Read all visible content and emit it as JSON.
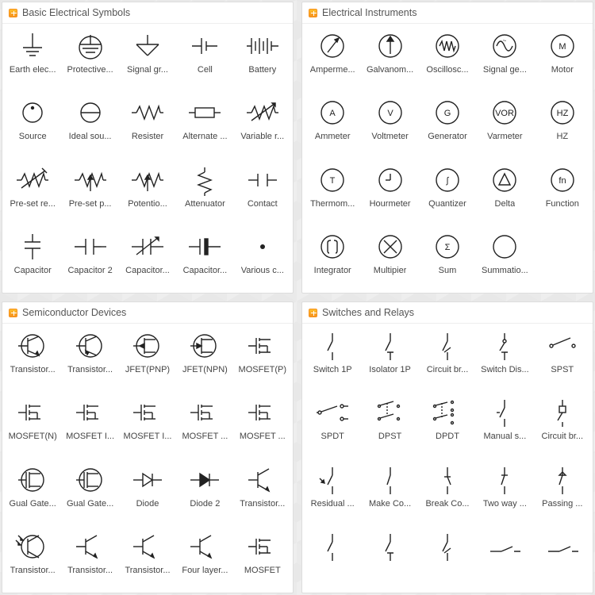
{
  "panels": [
    {
      "title": "Basic Electrical Symbols",
      "items": [
        {
          "label": "Earth elec...",
          "icon": "earth"
        },
        {
          "label": "Protective...",
          "icon": "earth-prot"
        },
        {
          "label": "Signal gr...",
          "icon": "signal-gnd"
        },
        {
          "label": "Cell",
          "icon": "cell"
        },
        {
          "label": "Battery",
          "icon": "battery"
        },
        {
          "label": "Source",
          "icon": "source"
        },
        {
          "label": "Ideal sou...",
          "icon": "ideal-source"
        },
        {
          "label": "Resister",
          "icon": "resistor"
        },
        {
          "label": "Alternate ...",
          "icon": "alt-resistor"
        },
        {
          "label": "Variable r...",
          "icon": "var-resistor"
        },
        {
          "label": "Pre-set re...",
          "icon": "preset-re"
        },
        {
          "label": "Pre-set p...",
          "icon": "preset-p"
        },
        {
          "label": "Potentio...",
          "icon": "potentio"
        },
        {
          "label": "Attenuator",
          "icon": "attenuator"
        },
        {
          "label": "Contact",
          "icon": "contact"
        },
        {
          "label": "Capacitor",
          "icon": "capacitor"
        },
        {
          "label": "Capacitor 2",
          "icon": "capacitor-2"
        },
        {
          "label": "Capacitor...",
          "icon": "capacitor-arrow"
        },
        {
          "label": "Capacitor...",
          "icon": "capacitor-pol"
        },
        {
          "label": "Various c...",
          "icon": "dot"
        }
      ]
    },
    {
      "title": "Electrical Instruments",
      "items": [
        {
          "label": "Amperme...",
          "icon": "circle-needle"
        },
        {
          "label": "Galvanom...",
          "icon": "circle-arrow"
        },
        {
          "label": "Oscillosc...",
          "icon": "circle-wave"
        },
        {
          "label": "Signal ge...",
          "icon": "circle-sine"
        },
        {
          "label": "Motor",
          "icon": "circle-text",
          "text": "M"
        },
        {
          "label": "Ammeter",
          "icon": "circle-text",
          "text": "A"
        },
        {
          "label": "Voltmeter",
          "icon": "circle-text",
          "text": "V"
        },
        {
          "label": "Generator",
          "icon": "circle-text",
          "text": "G"
        },
        {
          "label": "Varmeter",
          "icon": "circle-text",
          "text": "VOR"
        },
        {
          "label": "HZ",
          "icon": "circle-text",
          "text": "HZ"
        },
        {
          "label": "Thermom...",
          "icon": "circle-text",
          "text": "T"
        },
        {
          "label": "Hourmeter",
          "icon": "circle-hour"
        },
        {
          "label": "Quantizer",
          "icon": "circle-text",
          "text": "∫"
        },
        {
          "label": "Delta",
          "icon": "circle-delta"
        },
        {
          "label": "Function",
          "icon": "circle-text",
          "text": "fn"
        },
        {
          "label": "Integrator",
          "icon": "circle-integrator"
        },
        {
          "label": "Multipier",
          "icon": "circle-mult"
        },
        {
          "label": "Sum",
          "icon": "circle-text",
          "text": "Σ"
        },
        {
          "label": "Summatio...",
          "icon": "circle-blank"
        }
      ]
    },
    {
      "title": "Semiconductor Devices",
      "items": [
        {
          "label": "Transistor...",
          "icon": "transistor-circle-l"
        },
        {
          "label": "Transistor...",
          "icon": "transistor-circle-r"
        },
        {
          "label": "JFET(PNP)",
          "icon": "jfet-pnp"
        },
        {
          "label": "JFET(NPN)",
          "icon": "jfet-npn"
        },
        {
          "label": "MOSFET(P)",
          "icon": "mosfet-p"
        },
        {
          "label": "MOSFET(N)",
          "icon": "mosfet-n"
        },
        {
          "label": "MOSFET I...",
          "icon": "mosfet"
        },
        {
          "label": "MOSFET I...",
          "icon": "mosfet"
        },
        {
          "label": "MOSFET ...",
          "icon": "mosfet"
        },
        {
          "label": "MOSFET ...",
          "icon": "mosfet"
        },
        {
          "label": "Gual Gate...",
          "icon": "mosfet-circle"
        },
        {
          "label": "Gual Gate...",
          "icon": "mosfet-circle"
        },
        {
          "label": "Diode",
          "icon": "diode"
        },
        {
          "label": "Diode 2",
          "icon": "diode-filled"
        },
        {
          "label": "Transistor...",
          "icon": "transistor-plain"
        },
        {
          "label": "Transistor...",
          "icon": "transistor-photo"
        },
        {
          "label": "Transistor...",
          "icon": "transistor-plain"
        },
        {
          "label": "Transistor...",
          "icon": "transistor-plain"
        },
        {
          "label": "Four layer...",
          "icon": "transistor-plain"
        },
        {
          "label": "MOSFET",
          "icon": "mosfet"
        }
      ]
    },
    {
      "title": "Switches and Relays",
      "items": [
        {
          "label": "Switch 1P",
          "icon": "switch-1p"
        },
        {
          "label": "Isolator 1P",
          "icon": "isolator-1p"
        },
        {
          "label": "Circuit br...",
          "icon": "switch-break"
        },
        {
          "label": "Switch Dis...",
          "icon": "switch-disconn"
        },
        {
          "label": "SPST",
          "icon": "spst"
        },
        {
          "label": "SPDT",
          "icon": "spdt"
        },
        {
          "label": "DPST",
          "icon": "dpst"
        },
        {
          "label": "DPDT",
          "icon": "dpdt"
        },
        {
          "label": "Manual s...",
          "icon": "manual-switch"
        },
        {
          "label": "Circuit br...",
          "icon": "fuse-switch"
        },
        {
          "label": "Residual ...",
          "icon": "residual"
        },
        {
          "label": "Make Co...",
          "icon": "make-contact"
        },
        {
          "label": "Break Co...",
          "icon": "break-contact"
        },
        {
          "label": "Two way ...",
          "icon": "two-way"
        },
        {
          "label": "Passing ...",
          "icon": "passing"
        },
        {
          "label": "",
          "icon": "switch-1p"
        },
        {
          "label": "",
          "icon": "isolator-1p"
        },
        {
          "label": "",
          "icon": "switch-break"
        },
        {
          "label": "",
          "icon": "switch-low"
        },
        {
          "label": "",
          "icon": "switch-low"
        }
      ]
    }
  ]
}
